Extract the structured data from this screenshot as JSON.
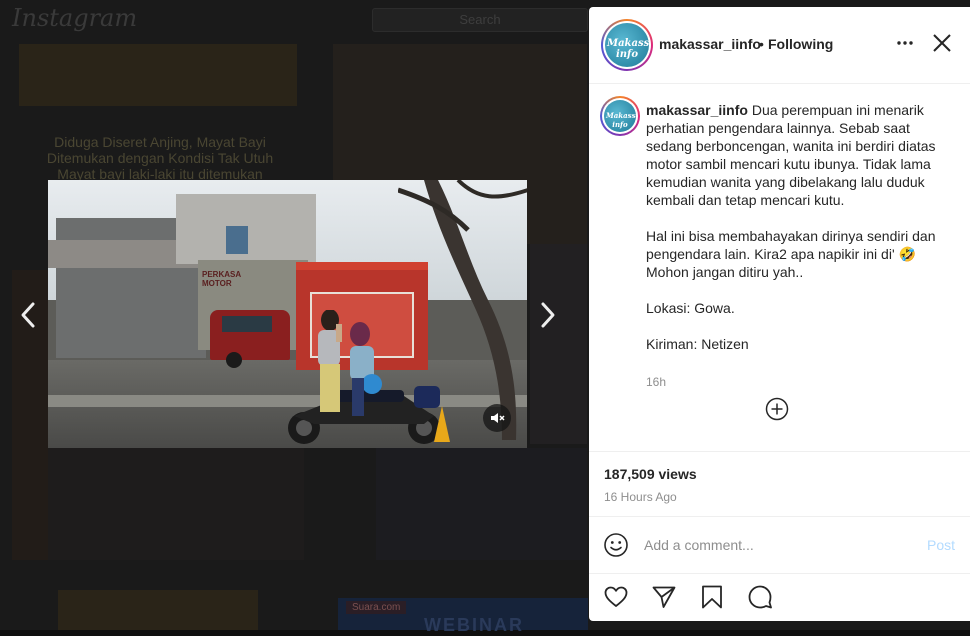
{
  "background": {
    "logo": "Instagram",
    "search_placeholder": "Search",
    "tile_caption": "Diduga Diseret Anjing, Mayat Bayi Ditemukan dengan Kondisi Tak Utuh\nMayat bayi laki-laki itu ditemukan",
    "webinar_badge": "Suara.com",
    "webinar_text": "WEBINAR"
  },
  "carousel": {
    "prev_icon": "chevron-left-icon",
    "next_icon": "chevron-right-icon"
  },
  "video": {
    "mute_icon": "speaker-muted-icon",
    "shop_sign": "PERKASA\nMOTOR"
  },
  "post": {
    "header": {
      "avatar_text": "Makassar info",
      "username": "makassar_iinfo",
      "separator": "•",
      "follow_status": "Following",
      "more_icon": "more-horizontal-icon",
      "close_icon": "close-icon"
    },
    "caption": {
      "username": "makassar_iinfo",
      "text": "Dua perempuan ini menarik perhatian pengendara lainnya. Sebab saat sedang berboncengan, wanita ini berdiri diatas motor sambil mencari kutu ibunya. Tidak lama kemudian wanita yang dibelakang lalu duduk kembali dan tetap mencari kutu.\n\nHal ini bisa membahayakan dirinya sendiri dan pengendara lain. Kira2 apa napikir ini di' 🤣 Mohon jangan ditiru yah..\n\nLokasi: Gowa.\n\nKiriman: Netizen",
      "time": "16h",
      "load_more_icon": "plus-circle-icon"
    },
    "stats": {
      "views": "187,509 views",
      "date": "16 Hours Ago"
    },
    "comment": {
      "emoji_icon": "smiley-icon",
      "placeholder": "Add a comment...",
      "post_label": "Post",
      "post_color": "#b3dbff"
    },
    "actions": [
      "heart-icon",
      "share-icon",
      "bookmark-icon",
      "comment-icon"
    ]
  }
}
